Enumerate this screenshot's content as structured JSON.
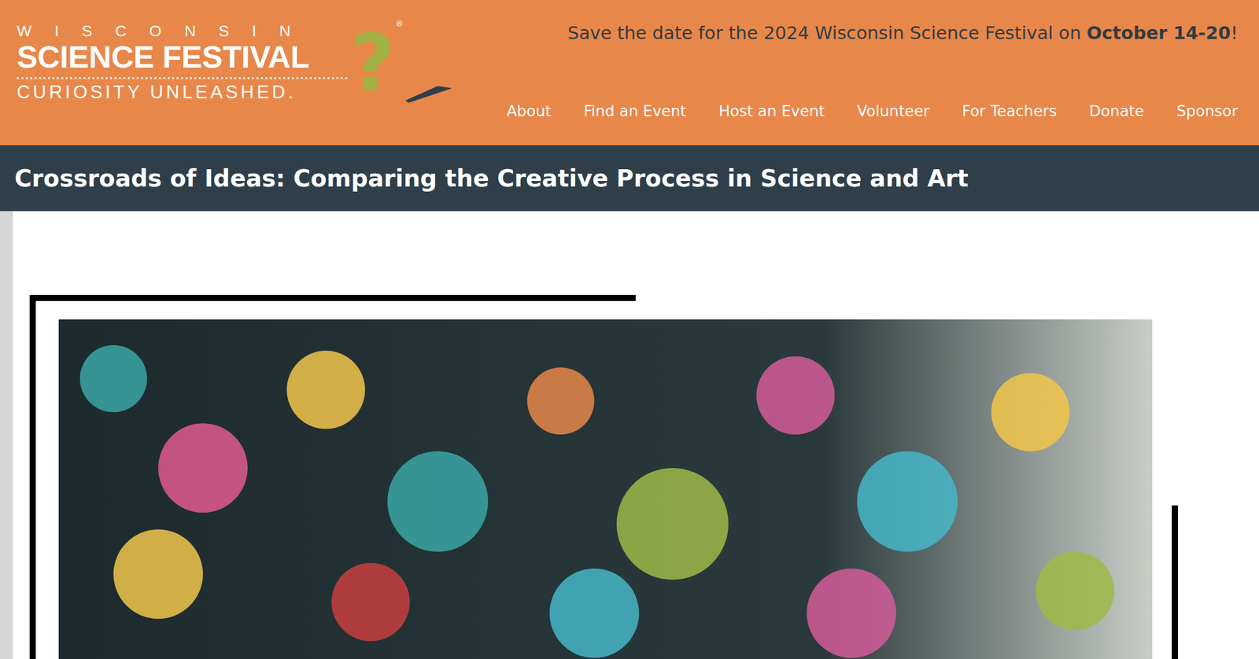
{
  "logo": {
    "top": "WISCONSIN",
    "main": "SCIENCE FESTIVAL",
    "tagline": "CURIOSITY UNLEASHED.",
    "registered": "®",
    "mark": "?"
  },
  "announcement": {
    "before": "Save the date for the 2024 Wisconsin Science Festival on ",
    "highlight": "October 14-20",
    "after": "!"
  },
  "nav": [
    {
      "label": "About"
    },
    {
      "label": "Find an Event"
    },
    {
      "label": "Host an Event"
    },
    {
      "label": "Volunteer"
    },
    {
      "label": "For Teachers"
    },
    {
      "label": "Donate"
    },
    {
      "label": "Sponsor"
    }
  ],
  "page": {
    "title": "Crossroads of Ideas: Comparing the Creative Process in Science and Art"
  }
}
